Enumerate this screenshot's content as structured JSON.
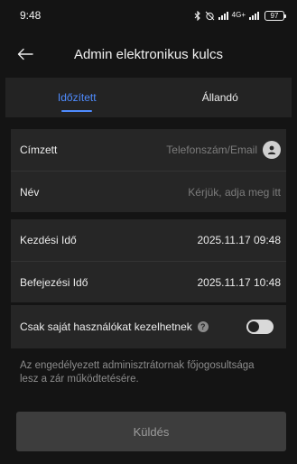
{
  "status_bar": {
    "time": "9:48",
    "network": "4G+",
    "battery": "97"
  },
  "header": {
    "title": "Admin elektronikus kulcs"
  },
  "tabs": [
    {
      "label": "Időzített",
      "active": true
    },
    {
      "label": "Állandó",
      "active": false
    }
  ],
  "recipient": {
    "label": "Címzett",
    "placeholder": "Telefonszám/Email"
  },
  "name": {
    "label": "Név",
    "placeholder": "Kérjük, adja meg itt"
  },
  "start_time": {
    "label": "Kezdési Idő",
    "value": "2025.11.17 09:48"
  },
  "end_time": {
    "label": "Befejezési Idő",
    "value": "2025.11.17 10:48"
  },
  "manage_own_users": {
    "label": "Csak saját használókat kezelhetnek",
    "enabled": false
  },
  "note": "Az engedélyezett adminisztrátornak főjogosultsága lesz a zár működtetésére.",
  "send_button": "Küldés",
  "colors": {
    "background": "#141414",
    "card": "#262626",
    "accent": "#4f8cff",
    "button_disabled": "#3d3d3d"
  }
}
